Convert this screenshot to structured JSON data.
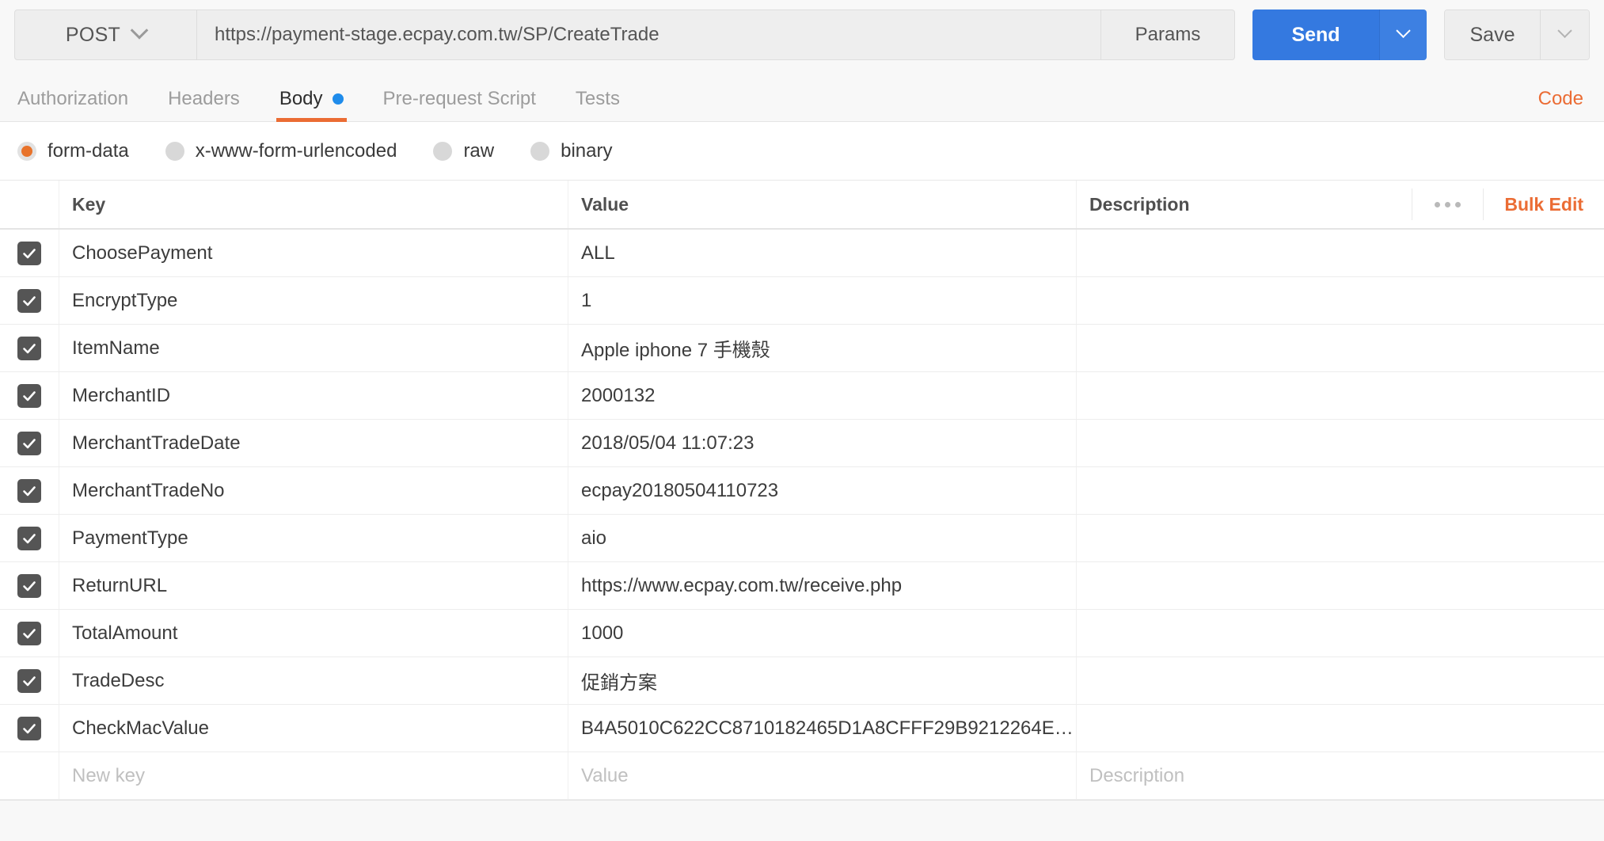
{
  "request": {
    "method": "POST",
    "url": "https://payment-stage.ecpay.com.tw/SP/CreateTrade",
    "params_label": "Params",
    "send_label": "Send",
    "save_label": "Save"
  },
  "tabs": [
    {
      "label": "Authorization",
      "active": false,
      "dot": false
    },
    {
      "label": "Headers",
      "active": false,
      "dot": false
    },
    {
      "label": "Body",
      "active": true,
      "dot": true
    },
    {
      "label": "Pre-request Script",
      "active": false,
      "dot": false
    },
    {
      "label": "Tests",
      "active": false,
      "dot": false
    }
  ],
  "code_link": "Code",
  "body_types": [
    {
      "label": "form-data",
      "selected": true
    },
    {
      "label": "x-www-form-urlencoded",
      "selected": false
    },
    {
      "label": "raw",
      "selected": false
    },
    {
      "label": "binary",
      "selected": false
    }
  ],
  "table": {
    "columns": {
      "key": "Key",
      "value": "Value",
      "description": "Description"
    },
    "bulk_edit": "Bulk Edit",
    "rows": [
      {
        "checked": true,
        "key": "ChoosePayment",
        "value": "ALL",
        "description": ""
      },
      {
        "checked": true,
        "key": "EncryptType",
        "value": "1",
        "description": ""
      },
      {
        "checked": true,
        "key": "ItemName",
        "value": "Apple iphone 7 手機殼",
        "description": ""
      },
      {
        "checked": true,
        "key": "MerchantID",
        "value": "2000132",
        "description": ""
      },
      {
        "checked": true,
        "key": "MerchantTradeDate",
        "value": "2018/05/04 11:07:23",
        "description": ""
      },
      {
        "checked": true,
        "key": "MerchantTradeNo",
        "value": "ecpay20180504110723",
        "description": ""
      },
      {
        "checked": true,
        "key": "PaymentType",
        "value": "aio",
        "description": ""
      },
      {
        "checked": true,
        "key": "ReturnURL",
        "value": "https://www.ecpay.com.tw/receive.php",
        "description": ""
      },
      {
        "checked": true,
        "key": "TotalAmount",
        "value": "1000",
        "description": ""
      },
      {
        "checked": true,
        "key": "TradeDesc",
        "value": "促銷方案",
        "description": ""
      },
      {
        "checked": true,
        "key": "CheckMacValue",
        "value": "B4A5010C622CC8710182465D1A8CFFF29B9212264E…",
        "description": ""
      }
    ],
    "new_row": {
      "key": "New key",
      "value": "Value",
      "description": "Description"
    }
  },
  "colors": {
    "accent_orange": "#eb6c34",
    "send_blue": "#3479e0",
    "dot_blue": "#1f8ceb",
    "checkbox": "#555555"
  }
}
